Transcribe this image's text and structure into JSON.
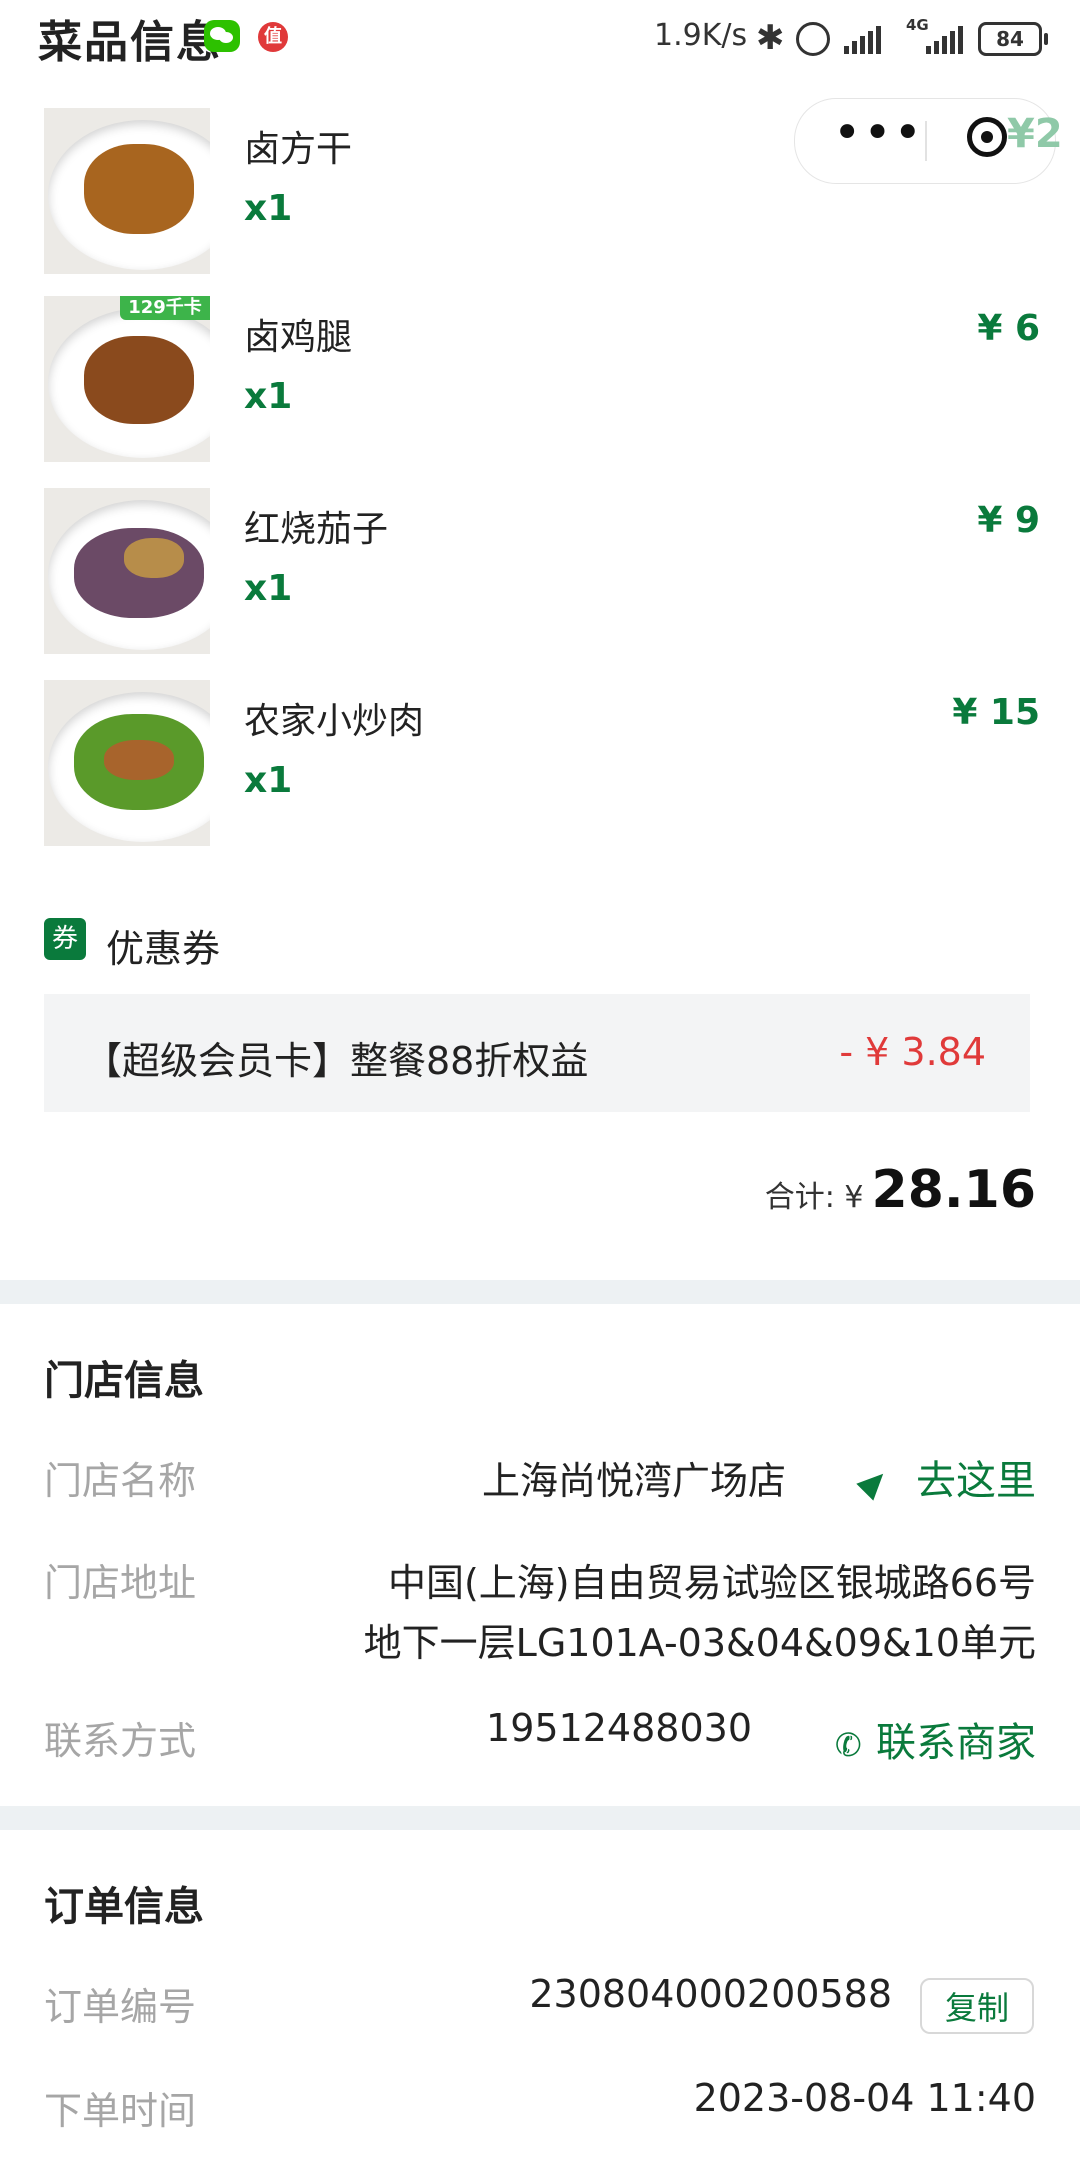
{
  "status_bar": {
    "page_title": "菜品信息",
    "network_speed": "1.9K/s",
    "signal_type": "4G",
    "battery": "84",
    "zhi_badge": "值"
  },
  "capsule": {
    "more_label": "•••",
    "peek_price": "¥2"
  },
  "dishes": [
    {
      "name": "卤方干",
      "qty": "x1",
      "price": ""
    },
    {
      "name": "卤鸡腿",
      "qty": "x1",
      "price": "¥ 6",
      "badge": "129千卡"
    },
    {
      "name": "红烧茄子",
      "qty": "x1",
      "price": "¥ 9"
    },
    {
      "name": "农家小炒肉",
      "qty": "x1",
      "price": "¥ 15"
    }
  ],
  "coupon": {
    "badge": "券",
    "title": "优惠券",
    "text": "【超级会员卡】整餐88折权益",
    "value": "- ¥ 3.84"
  },
  "total": {
    "label": "合计: ¥",
    "value": "28.16"
  },
  "store": {
    "title": "门店信息",
    "name_label": "门店名称",
    "name_value": "上海尚悦湾广场店",
    "go_label": "去这里",
    "addr_label": "门店地址",
    "addr_line1": "中国(上海)自由贸易试验区银城路66号",
    "addr_line2": "地下一层LG101A-03&04&09&10单元",
    "contact_label": "联系方式",
    "contact_value": "19512488030",
    "contact_btn": "联系商家"
  },
  "order": {
    "title": "订单信息",
    "id_label": "订单编号",
    "id_value": "230804000200588",
    "copy_btn": "复制",
    "time_label": "下单时间",
    "time_value": "2023-08-04 11:40"
  },
  "colors": {
    "accent_green": "#0a7a3c",
    "discount_red": "#e03a3a",
    "divider": "#edf1f3"
  }
}
